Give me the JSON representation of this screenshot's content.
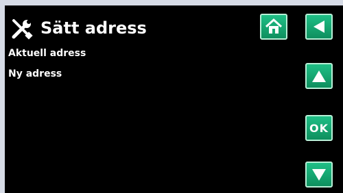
{
  "header": {
    "title": "Sätt adress",
    "icon": "tools-icon",
    "home_icon": "home-icon",
    "back_icon": "back-arrow-icon"
  },
  "main": {
    "current_address_label": "Aktuell adress",
    "new_address_label": "Ny adress"
  },
  "nav": {
    "ok_label": "OK",
    "up_icon": "up-arrow-icon",
    "down_icon": "down-arrow-icon"
  },
  "colors": {
    "background": "#000000",
    "accent_green": "#13a870",
    "text": "#ffffff"
  }
}
